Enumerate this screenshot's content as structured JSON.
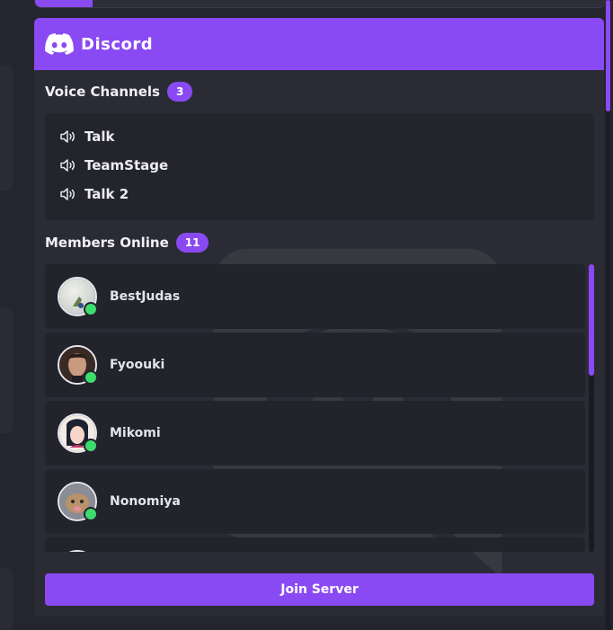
{
  "widget": {
    "title": "Discord",
    "accent_color": "#8a4af3",
    "logo_icon": "discord-logo-icon"
  },
  "voice_channels": {
    "heading": "Voice Channels",
    "count": "3",
    "icon": "speaker-icon",
    "items": [
      {
        "label": "Talk"
      },
      {
        "label": "TeamStage"
      },
      {
        "label": "Talk 2"
      }
    ]
  },
  "members": {
    "heading": "Members Online",
    "count": "11",
    "status_color": "#3ddc6f",
    "items": [
      {
        "name": "BestJudas",
        "status": "online"
      },
      {
        "name": "Fyoouki",
        "status": "online"
      },
      {
        "name": "Mikomi",
        "status": "online"
      },
      {
        "name": "Nonomiya",
        "status": "online"
      },
      {
        "name": "",
        "status": "online"
      }
    ]
  },
  "join_button": {
    "label": "Join Server"
  }
}
